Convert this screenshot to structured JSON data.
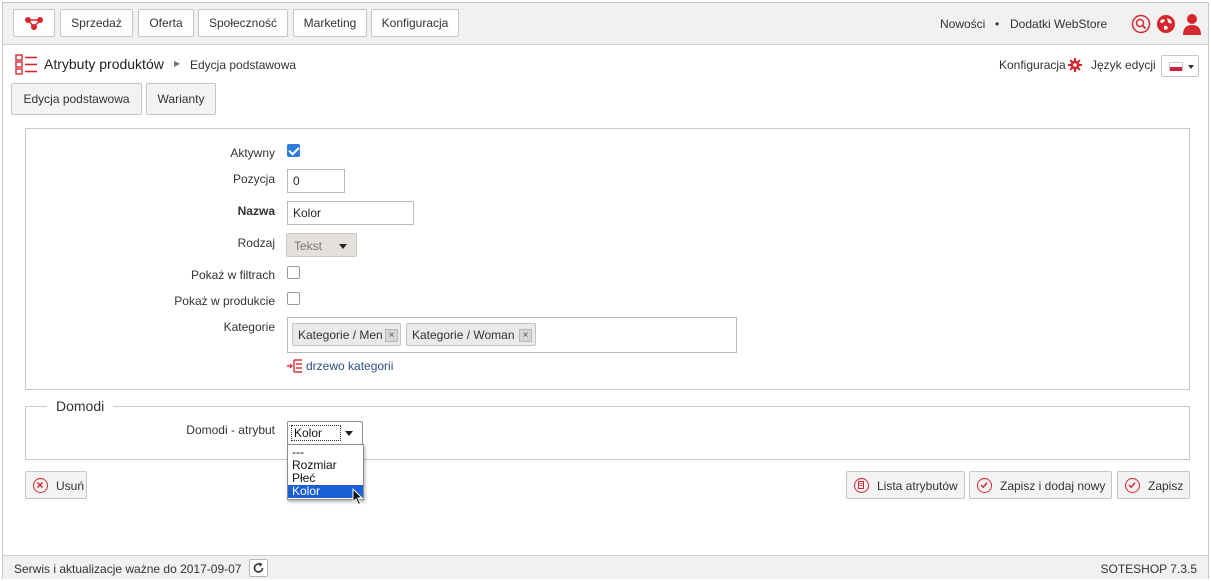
{
  "nav": {
    "items": [
      "Sprzedaż",
      "Oferta",
      "Społeczność",
      "Marketing",
      "Konfiguracja"
    ],
    "right_links": [
      "Nowości",
      "•",
      "Dodatki WebStore"
    ]
  },
  "header": {
    "title": "Atrybuty produktów",
    "breadcrumb": "Edycja podstawowa",
    "config_link": "Konfiguracja",
    "language_label": "Język edycji"
  },
  "tabs": [
    "Edycja podstawowa",
    "Warianty"
  ],
  "form": {
    "aktywny_label": "Aktywny",
    "aktywny_checked": true,
    "pozycja_label": "Pozycja",
    "pozycja_value": "0",
    "nazwa_label": "Nazwa",
    "nazwa_value": "Kolor",
    "rodzaj_label": "Rodzaj",
    "rodzaj_value": "Tekst",
    "filtry_label": "Pokaż w filtrach",
    "filtry_checked": false,
    "produkcie_label": "Pokaż w produkcie",
    "produkcie_checked": false,
    "kategorie_label": "Kategorie",
    "kategorie_tags": [
      "Kategorie / Men",
      "Kategorie / Woman"
    ],
    "tag_remove": "×",
    "tree_link": "drzewo kategorii"
  },
  "domodi": {
    "legend": "Domodi",
    "label": "Domodi - atrybut",
    "selected": "Kolor",
    "options": [
      "---",
      "Rozmiar",
      "Płeć",
      "Kolor"
    ]
  },
  "actions": {
    "delete": "Usuń",
    "list": "Lista atrybutów",
    "save_new": "Zapisz i dodaj nowy",
    "save": "Zapisz"
  },
  "footer": {
    "service_text": "Serwis i aktualizacje ważne do 2017-09-07",
    "version": "SOTESHOP 7.3.5"
  },
  "colors": {
    "accent": "#d6272f",
    "link": "#2d4f84",
    "selection": "#1b5fd6"
  }
}
